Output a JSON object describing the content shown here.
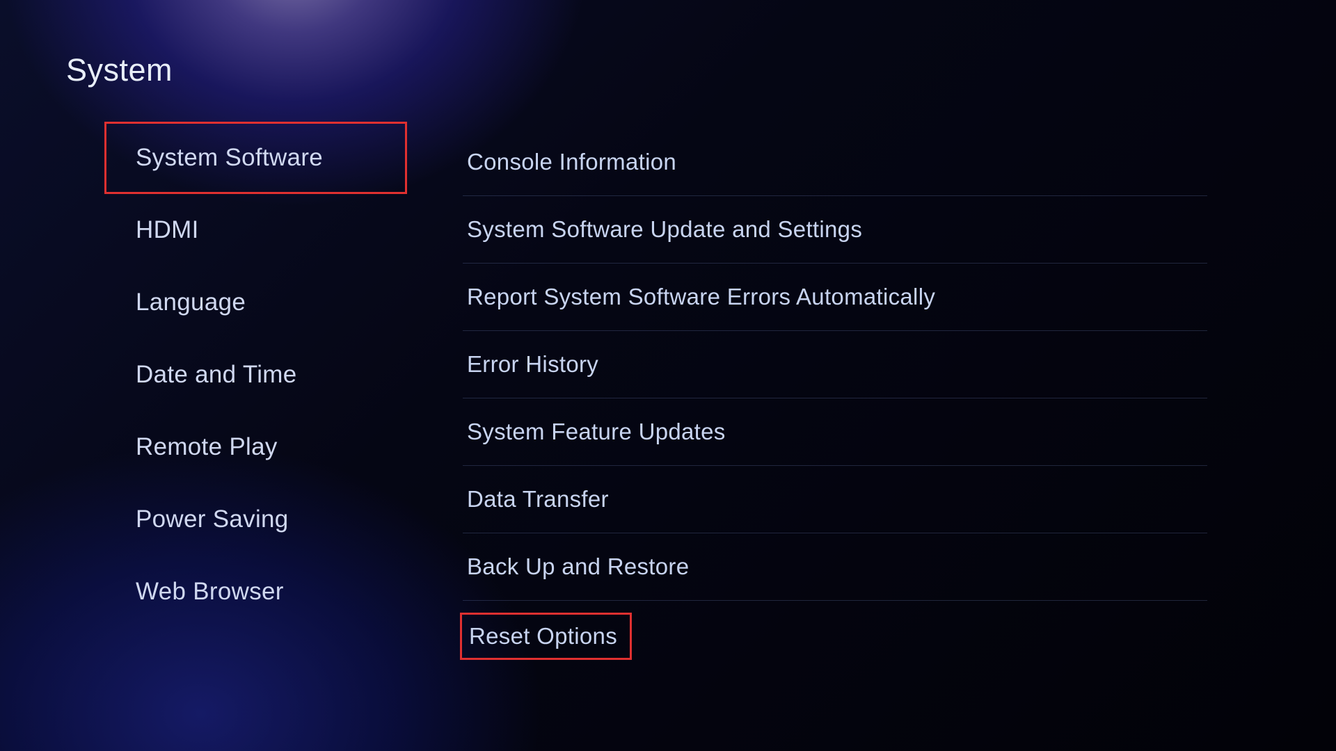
{
  "page_title": "System",
  "sidebar": {
    "items": [
      {
        "label": "System Software",
        "highlighted": true
      },
      {
        "label": "HDMI",
        "highlighted": false
      },
      {
        "label": "Language",
        "highlighted": false
      },
      {
        "label": "Date and Time",
        "highlighted": false
      },
      {
        "label": "Remote Play",
        "highlighted": false
      },
      {
        "label": "Power Saving",
        "highlighted": false
      },
      {
        "label": "Web Browser",
        "highlighted": false
      }
    ]
  },
  "content": {
    "items": [
      {
        "label": "Console Information",
        "highlighted": false
      },
      {
        "label": "System Software Update and Settings",
        "highlighted": false
      },
      {
        "label": "Report System Software Errors Automatically",
        "highlighted": false
      },
      {
        "label": "Error History",
        "highlighted": false
      },
      {
        "label": "System Feature Updates",
        "highlighted": false
      },
      {
        "label": "Data Transfer",
        "highlighted": false
      },
      {
        "label": "Back Up and Restore",
        "highlighted": false
      },
      {
        "label": "Reset Options",
        "highlighted": true
      }
    ]
  },
  "colors": {
    "highlight_border": "#e03030",
    "text_primary": "#e8eef8",
    "text_secondary": "#c8d4f0"
  }
}
